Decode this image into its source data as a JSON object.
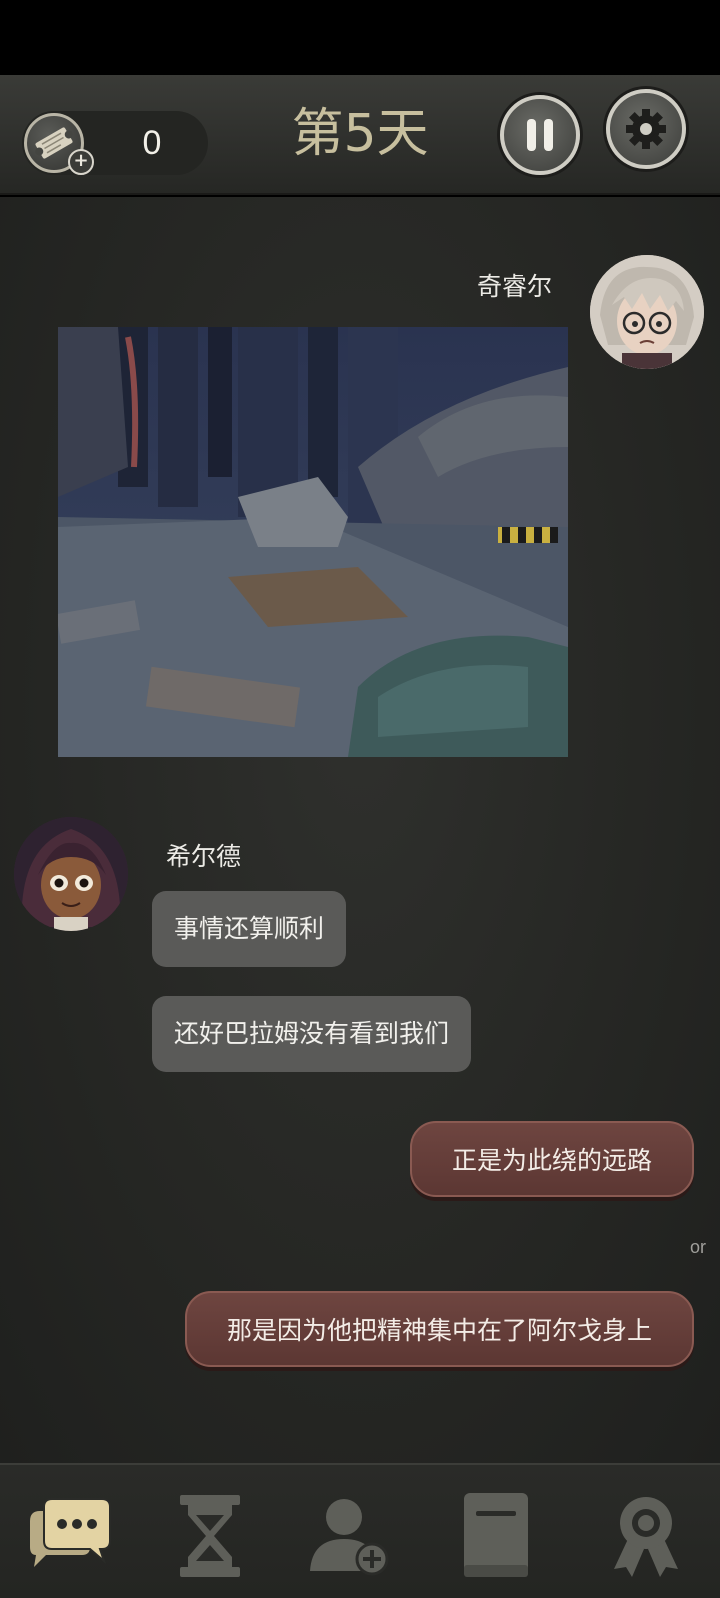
{
  "header": {
    "ticket_count": "0",
    "day_label": "第5天"
  },
  "chat": {
    "messages": [
      {
        "sender": "奇睿尔",
        "type": "image"
      },
      {
        "sender": "希尔德",
        "texts": [
          "事情还算顺利",
          "还好巴拉姆没有看到我们"
        ]
      }
    ],
    "choices": [
      "正是为此绕的远路",
      "那是因为他把精神集中在了阿尔戈身上"
    ],
    "or_label": "or"
  },
  "colors": {
    "day_title": "#c7bf9e",
    "npc_bubble": "#5a5a58",
    "choice_bubble": "#6e4540",
    "active_nav": "#e3d3a3",
    "inactive_nav": "#5e5f59"
  },
  "nav": {
    "items": [
      {
        "icon": "chat-bubbles-icon",
        "active": true
      },
      {
        "icon": "hourglass-icon",
        "active": false
      },
      {
        "icon": "add-contact-icon",
        "active": false
      },
      {
        "icon": "journal-book-icon",
        "active": false
      },
      {
        "icon": "achievement-ribbon-icon",
        "active": false
      }
    ]
  }
}
